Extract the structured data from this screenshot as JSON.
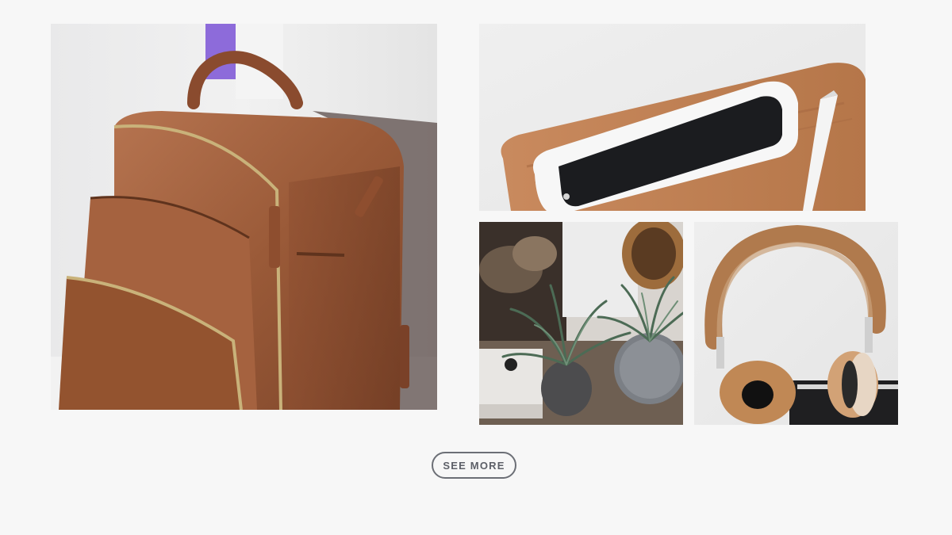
{
  "gallery": {
    "tiles": [
      {
        "subject": "backpack-photo",
        "alt": ""
      },
      {
        "subject": "phone-photo",
        "alt": ""
      },
      {
        "subject": "plants-photo",
        "alt": ""
      },
      {
        "subject": "headphones-photo",
        "alt": ""
      }
    ]
  },
  "actions": {
    "see_more_label": "SEE MORE"
  },
  "colors": {
    "background": "#f7f7f7",
    "leather": "#a8643f",
    "button_border": "#6c6f76",
    "button_text": "#5d6068"
  }
}
